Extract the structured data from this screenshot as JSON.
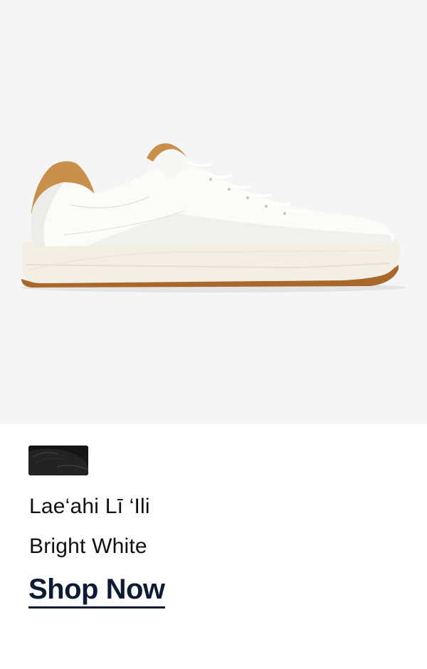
{
  "product": {
    "name": "Lae‘ahi Lī ‘Ili",
    "color_name": "Bright White",
    "cta_label": "Shop Now",
    "swatch_icon": "black-sneaker-swatch-icon",
    "image_icon": "white-leather-sneaker-image"
  },
  "colors": {
    "hero_background": "#f5f5f5",
    "cta_text": "#0d1b33",
    "body_text": "#111111",
    "swatch_dark": "#1a1a1a"
  }
}
